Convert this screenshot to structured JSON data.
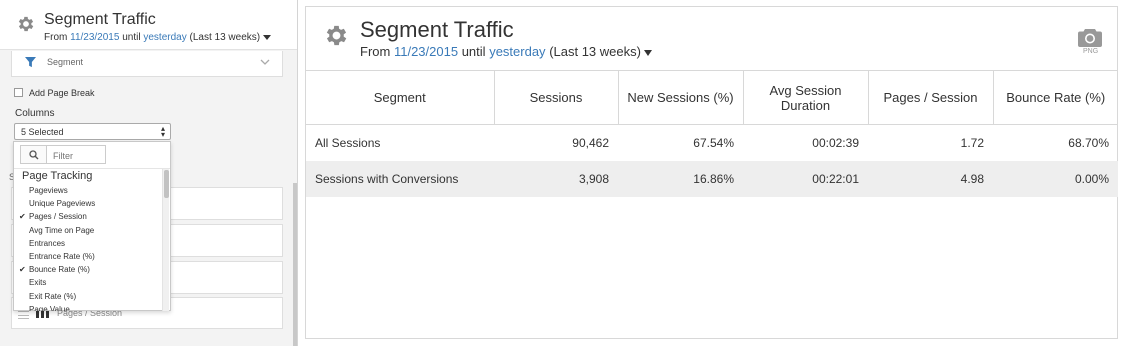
{
  "editor": {
    "title": "Segment Traffic",
    "range_prefix": "From",
    "start_date": "11/23/2015",
    "until_text": "until",
    "end_label": "yesterday",
    "range_note": "(Last 13 weeks)",
    "segment_filter_label": "Segment",
    "page_break_label": "Add Page Break",
    "columns_label": "Columns",
    "columns_selected": "5 Selected",
    "filter_placeholder": "Filter",
    "stray_letter": "S",
    "background_rows": [
      "",
      "",
      "",
      "Pages / Session"
    ],
    "dropdown": {
      "group": "Page Tracking",
      "items": [
        {
          "label": "Pageviews",
          "checked": false
        },
        {
          "label": "Unique Pageviews",
          "checked": false
        },
        {
          "label": "Pages / Session",
          "checked": true
        },
        {
          "label": "Avg Time on Page",
          "checked": false
        },
        {
          "label": "Entrances",
          "checked": false
        },
        {
          "label": "Entrance Rate (%)",
          "checked": false
        },
        {
          "label": "Bounce Rate (%)",
          "checked": true
        },
        {
          "label": "Exits",
          "checked": false
        },
        {
          "label": "Exit Rate (%)",
          "checked": false
        },
        {
          "label": "Page Value",
          "checked": false
        }
      ]
    }
  },
  "main": {
    "title": "Segment Traffic",
    "range_prefix": "From",
    "start_date": "11/23/2015",
    "until_text": "until",
    "end_label": "yesterday",
    "range_note": "(Last 13 weeks)",
    "export_label": "PNG",
    "table": {
      "headers": [
        "Segment",
        "Sessions",
        "New Sessions (%)",
        "Avg Session Duration",
        "Pages / Session",
        "Bounce Rate (%)"
      ],
      "rows": [
        [
          "All Sessions",
          "90,462",
          "67.54%",
          "00:02:39",
          "1.72",
          "68.70%"
        ],
        [
          "Sessions with Conversions",
          "3,908",
          "16.86%",
          "00:22:01",
          "4.98",
          "0.00%"
        ]
      ]
    }
  },
  "colors": {
    "link": "#3a7ab8",
    "panel_bg": "#f3f3f3",
    "alt_row": "#eeeeee",
    "icon_gray": "#8a8a8a",
    "filter_icon": "#3a7ab8"
  }
}
